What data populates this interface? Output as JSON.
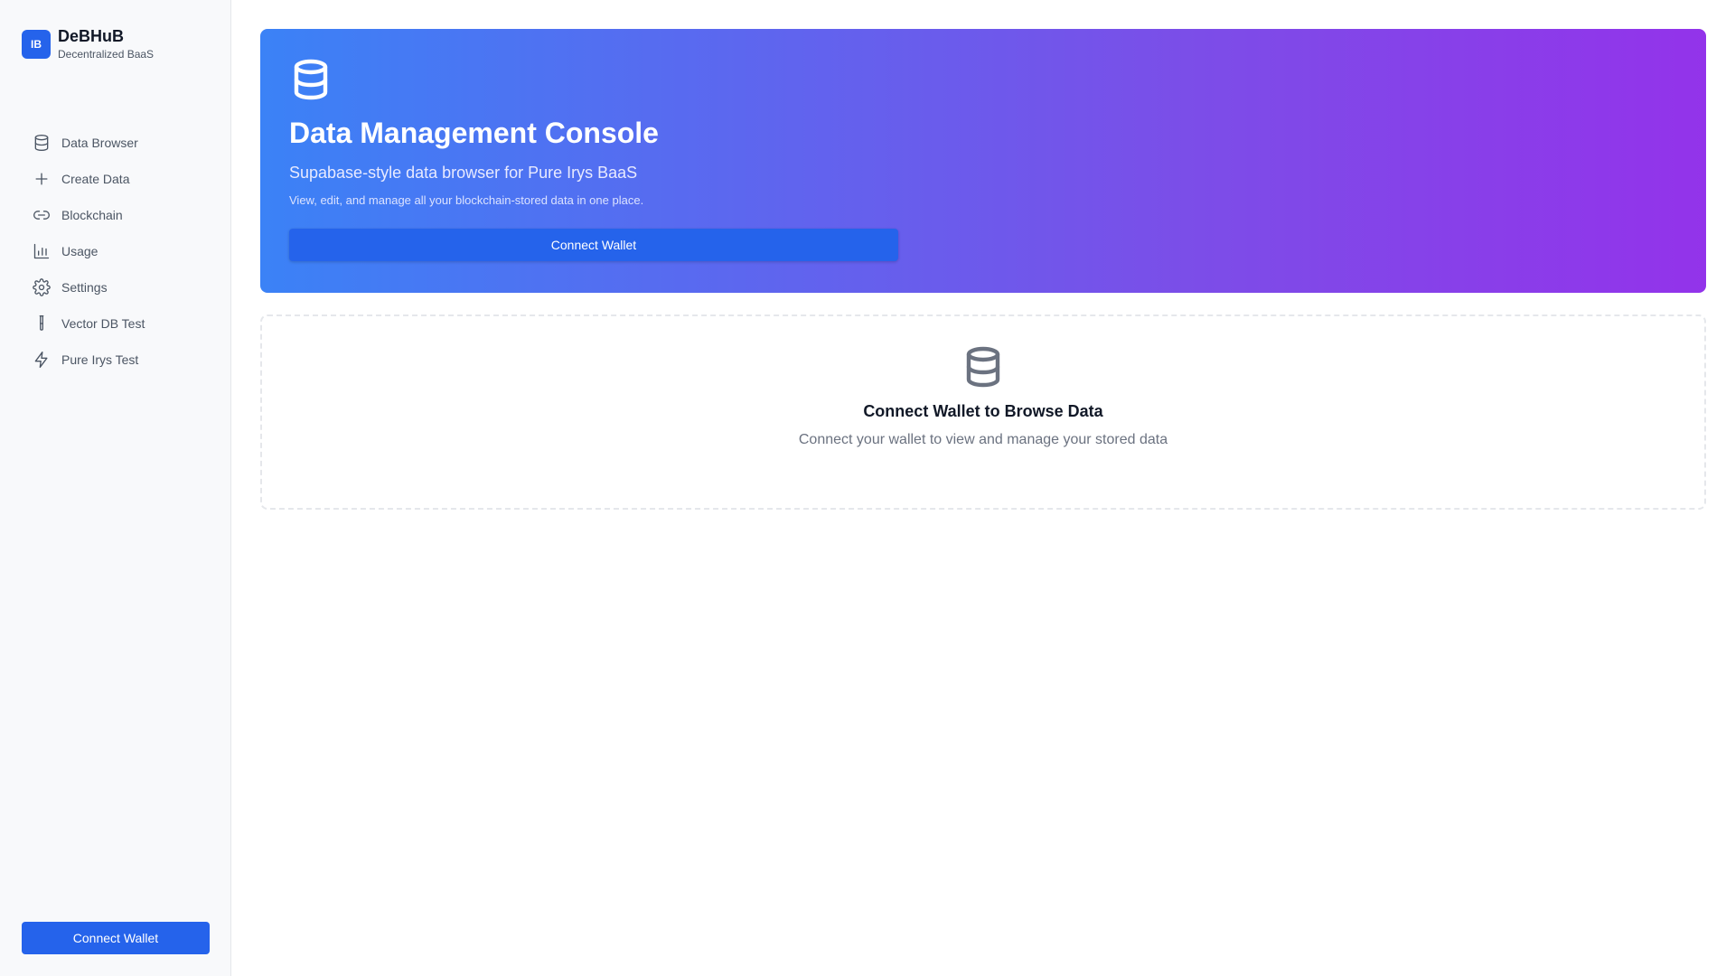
{
  "brand": {
    "logo_text": "IB",
    "name": "DeBHuB",
    "tagline": "Decentralized BaaS",
    "accent_color": "#2563eb"
  },
  "sidebar": {
    "items": [
      {
        "label": "Data Browser",
        "icon": "database-icon"
      },
      {
        "label": "Create Data",
        "icon": "plus-icon"
      },
      {
        "label": "Blockchain",
        "icon": "link-icon"
      },
      {
        "label": "Usage",
        "icon": "bar-chart-icon"
      },
      {
        "label": "Settings",
        "icon": "gear-icon"
      },
      {
        "label": "Vector DB Test",
        "icon": "test-tube-icon"
      },
      {
        "label": "Pure Irys Test",
        "icon": "zap-icon"
      }
    ],
    "connect_label": "Connect Wallet"
  },
  "hero": {
    "icon": "database-icon",
    "title": "Data Management Console",
    "subtitle": "Supabase-style data browser for Pure Irys BaaS",
    "description": "View, edit, and manage all your blockchain-stored data in one place.",
    "button_label": "Connect Wallet",
    "gradient_start": "#3b82f6",
    "gradient_end": "#9333ea"
  },
  "empty_state": {
    "icon": "database-icon",
    "title": "Connect Wallet to Browse Data",
    "description": "Connect your wallet to view and manage your stored data"
  }
}
